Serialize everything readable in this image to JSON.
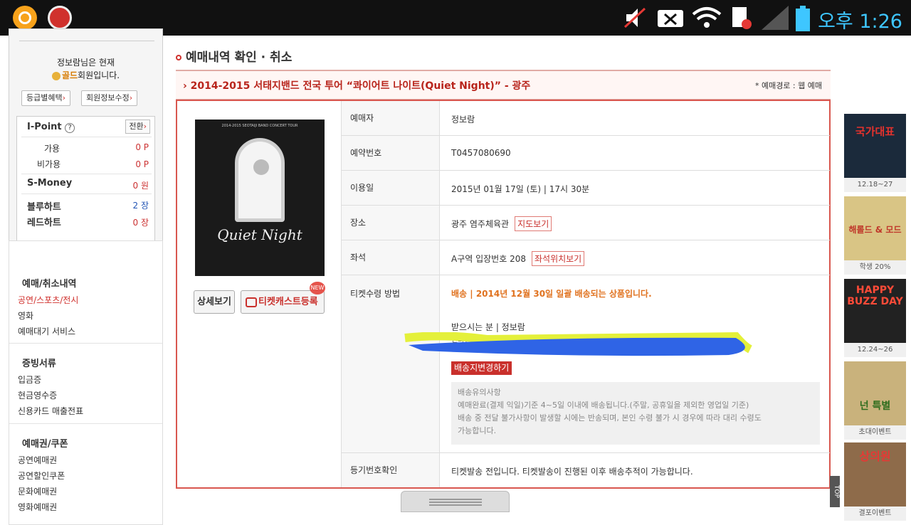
{
  "statusbar": {
    "time": "오후 1:26"
  },
  "sidebar": {
    "greeting_line1": "정보람님은 현재",
    "greeting_grade": "골드",
    "greeting_suffix": "회원입니다.",
    "btn_grade_benefit": "등급별혜택",
    "btn_member_edit": "회원정보수정",
    "ipoint": {
      "title": "I-Point",
      "help": "?",
      "convert": "전환",
      "available_label": "가용",
      "available_value": "0 P",
      "unavailable_label": "비가용",
      "unavailable_value": "0 P",
      "smoney_label": "S-Money",
      "smoney_value": "0 원",
      "bluehart_label": "블루하트",
      "bluehart_value": "2 장",
      "redhart_label": "레드하트",
      "redhart_value": "0 장"
    },
    "menu": [
      {
        "section": "예매/취소내역",
        "items": [
          "공연/스포츠/전시",
          "영화",
          "예매대기 서비스"
        ]
      },
      {
        "section": "증빙서류",
        "items": [
          "입금증",
          "현금영수증",
          "신용카드 매출전표"
        ]
      },
      {
        "section": "예매권/쿠폰",
        "items": [
          "공연예매권",
          "공연할인쿠폰",
          "문화예매권",
          "영화예매권"
        ]
      }
    ]
  },
  "main": {
    "page_title": "예매내역 확인 · 취소",
    "concert_title": "› 2014-2015 서태지밴드 전국 투어 “콰이어트 나이트(Quiet Night)” - 광주",
    "booking_route": "* 예매경로 : 웹 예매",
    "poster_header": "2014-2015 SEOTAIJI BAND CONCERT TOUR",
    "poster_title": "Quiet Night",
    "btn_detail": "상세보기",
    "btn_ticketcast": "티켓캐스트등록",
    "new_badge": "NEW",
    "rows": {
      "booker_label": "예매자",
      "booker_value": "정보람",
      "booking_no_label": "예약번호",
      "booking_no_value": "T0457080690",
      "date_label": "이용일",
      "date_value": "2015년 01월 17일 (토) | 17시 30분",
      "venue_label": "장소",
      "venue_value": "광주 염주체육관",
      "map_btn": "지도보기",
      "seat_label": "좌석",
      "seat_value": "A구역 입장번호 208",
      "seat_btn": "좌석위치보기",
      "receive_label": "티켓수령 방법",
      "delivery_text": "배송 | 2014년 12월 30일 일괄 배송되는 상품입니다.",
      "recipient": "받으시는 분 | 정보람",
      "phone": "전화번호 : 010-9738-0221 휴대폰 번호 : 010-9738-0221",
      "change_btn": "배송지변경하기",
      "notice_title": "배송유의사항",
      "notice_line1": "예매완료(결제 익일)기준 4~5일 이내에 배송됩니다.(주말, 공휴일을 제외한 영업일 기준)",
      "notice_line2": "배송 중 전달 불가사항이 발생할 시에는 반송되며, 본인 수령 불가 시 경우에 따라 대리 수령도",
      "notice_line3": "가능합니다.",
      "registered_label": "등기번호확인",
      "registered_value": "티켓발송 전입니다. 티켓발송이 진행된 이후 배송추적이 가능합니다."
    }
  },
  "ads": [
    {
      "title": "국가대표",
      "caption": "12.18~27"
    },
    {
      "title": "해롤드 & 모드",
      "caption": "학생 20%"
    },
    {
      "title": "HAPPY BUZZ DAY",
      "caption": "12.24~26"
    },
    {
      "title": "넌 특별",
      "caption": "초대이벤트"
    },
    {
      "title": "상의원",
      "caption": "결포이벤트"
    }
  ],
  "top_button": "TOP"
}
